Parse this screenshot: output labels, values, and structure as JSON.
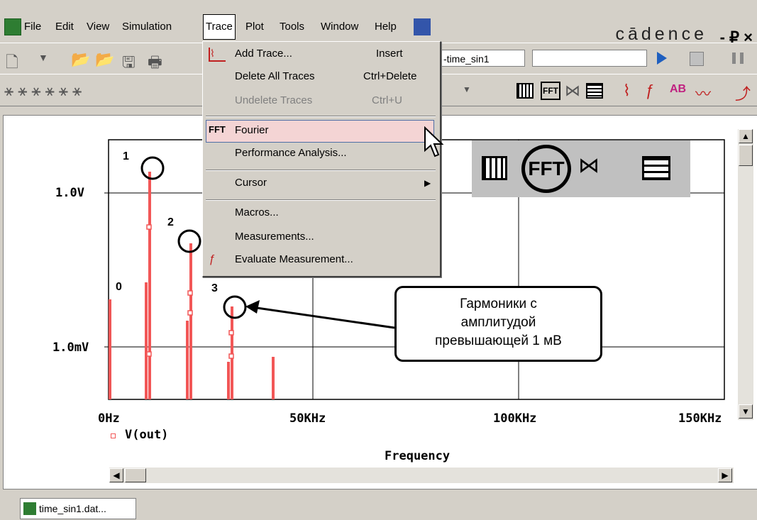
{
  "menubar": {
    "items": [
      "File",
      "Edit",
      "View",
      "Simulation",
      "Trace",
      "Plot",
      "Tools",
      "Window",
      "Help"
    ],
    "brand": "cādence",
    "window_controls": "- ₽ ×"
  },
  "toolbar": {
    "profile_combo": "-time_sin1",
    "run_icon": "play-icon",
    "pause_icon": "pause-icon"
  },
  "trace_menu": {
    "items": [
      {
        "label": "Add Trace...",
        "shortcut": "Insert",
        "icon": "add-trace-icon",
        "enabled": true
      },
      {
        "label": "Delete All Traces",
        "shortcut": "Ctrl+Delete",
        "enabled": true
      },
      {
        "label": "Undelete Traces",
        "shortcut": "Ctrl+U",
        "enabled": false
      },
      {
        "label": "Fourier",
        "shortcut": "",
        "icon": "fft-icon",
        "enabled": true,
        "highlighted": true
      },
      {
        "label": "Performance Analysis...",
        "shortcut": "",
        "enabled": true
      },
      {
        "label": "Cursor",
        "shortcut": "",
        "submenu": true,
        "enabled": true
      },
      {
        "label": "Macros...",
        "shortcut": "",
        "enabled": true
      },
      {
        "label": "Measurements...",
        "shortcut": "",
        "enabled": true
      },
      {
        "label": "Evaluate Measurement...",
        "shortcut": "",
        "icon": "evaluate-icon",
        "enabled": true
      }
    ]
  },
  "plot": {
    "y_ticks": [
      "1.0V",
      "1.0mV"
    ],
    "x_ticks": [
      "0Hz",
      "50KHz",
      "100KHz",
      "150KHz"
    ],
    "xlabel": "Frequency",
    "legend": "V(out)",
    "harmonic_labels": [
      "0",
      "1",
      "2",
      "3"
    ],
    "trace_color": "#f25757"
  },
  "callout": {
    "text_line1": "Гармоники с",
    "text_line2": "амплитудой",
    "text_line3": "превышающей 1 мВ"
  },
  "tabs": {
    "file_tab": "time_sin1.dat..."
  }
}
